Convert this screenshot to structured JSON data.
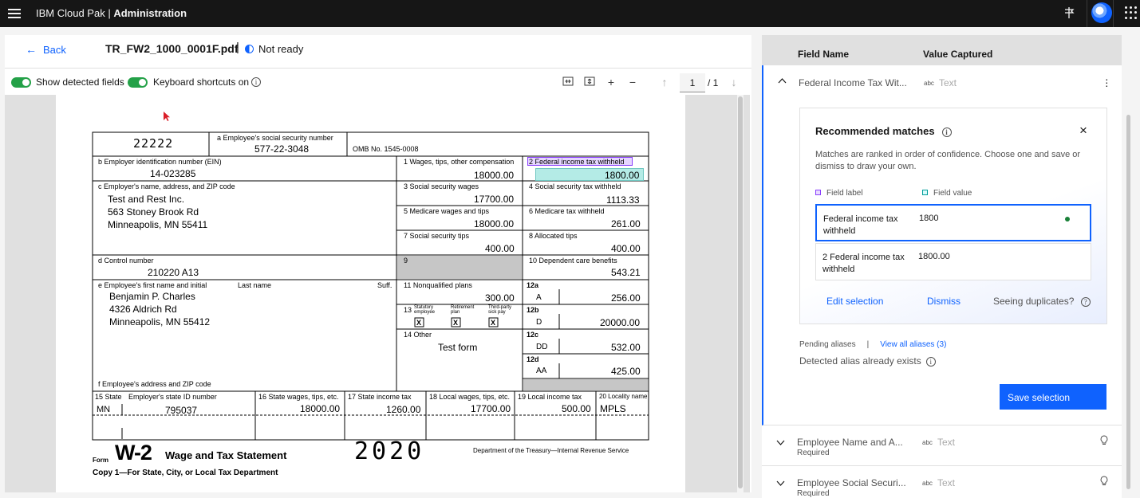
{
  "topbar": {
    "brand": "IBM Cloud Pak",
    "separator": " | ",
    "section": "Administration"
  },
  "doc": {
    "back_label": "Back",
    "filename": "TR_FW2_1000_0001F.pdf",
    "status": "Not ready"
  },
  "toolbar": {
    "show_fields": "Show detected fields",
    "shortcuts": "Keyboard shortcuts on",
    "page": "1",
    "page_total": "/ 1",
    "zoom_in": "+",
    "zoom_out": "−"
  },
  "w2": {
    "control_code": "22222",
    "ssn_label": "a Employee's social security number",
    "ssn": "577-22-3048",
    "omb": "OMB No. 1545-0008",
    "ein_label": "b Employer identification number (EIN)",
    "ein": "14-023285",
    "box1_label": "1  Wages, tips, other compensation",
    "box1": "18000.00",
    "box2_label": "2  Federal income tax withheld",
    "box2": "1800.00",
    "employer_label": "c Employer's name, address, and ZIP code",
    "employer_l1": "Test and  Rest  Inc.",
    "employer_l2": "563 Stoney Brook Rd",
    "employer_l3": "Minneapolis, MN 55411",
    "box3_label": "3  Social security wages",
    "box3": "17700.00",
    "box4_label": "4  Social security tax withheld",
    "box4": "1113.33",
    "box5_label": "5  Medicare wages and tips",
    "box5": "18000.00",
    "box6_label": "6  Medicare tax withheld",
    "box6": "261.00",
    "box7_label": "7  Social security tips",
    "box7": "400.00",
    "box8_label": "8  Allocated tips",
    "box8": "400.00",
    "control_label": "d Control number",
    "control": "210220 A13",
    "box9_label": "9",
    "box10_label": "10  Dependent care benefits",
    "box10": "543.21",
    "employee_label": "e Employee's first name and initial",
    "last_label": "Last name",
    "suff_label": "Suff.",
    "employee_l1": "Benjamin P. Charles",
    "employee_l2": "4326 Aldrich Rd",
    "employee_l3": "Minneapolis, MN 55412",
    "box11_label": "11  Nonqualified plans",
    "box11": "300.00",
    "box12a_label": "12a",
    "box12a_code": "A",
    "box12a": "256.00",
    "box13_label": "13",
    "box13_c1": "Statutory employee",
    "box13_c2": "Retirement plan",
    "box13_c3": "Third-party sick pay",
    "check": "X",
    "box12b_label": "12b",
    "box12b_code": "D",
    "box12b": "20000.00",
    "box14_label": "14  Other",
    "box14": "Test form",
    "box12c_label": "12c",
    "box12c_code": "DD",
    "box12c": "532.00",
    "box12d_label": "12d",
    "box12d_code": "AA",
    "box12d": "425.00",
    "code_letters": "Code",
    "emp_addr_label": "f Employee's address and ZIP code",
    "box15_label": "15 State",
    "state_id_label": "Employer's state ID number",
    "state": "MN",
    "state_id": "795037",
    "box16_label": "16  State wages, tips, etc.",
    "box16": "18000.00",
    "box17_label": "17  State income tax",
    "box17": "1260.00",
    "box18_label": "18  Local wages, tips, etc.",
    "box18": "17700.00",
    "box19_label": "19  Local income tax",
    "box19": "500.00",
    "box20_label": "20  Locality name",
    "box20": "MPLS",
    "form_word": "Form",
    "form_name": "W-2",
    "form_title": "Wage and Tax Statement",
    "year": "2020",
    "dept": "Department of the Treasury—Internal Revenue Service",
    "copy": "Copy 1—For State, City, or Local Tax Department"
  },
  "panel": {
    "col_field": "Field Name",
    "col_value": "Value Captured",
    "row1_name": "Federal Income Tax Wit...",
    "type_abbr": "abc",
    "type_text": "Text",
    "card_title": "Recommended matches",
    "card_desc": "Matches are ranked in order of confidence. Choose one and save or dismiss to draw your own.",
    "legend_label": "Field label",
    "legend_value": "Field value",
    "opt1_label": "Federal income tax withheld",
    "opt1_value": "1800",
    "opt2_label": "2 Federal income tax withheld",
    "opt2_value": "1800.00",
    "edit": "Edit selection",
    "dismiss": "Dismiss",
    "dup": "Seeing duplicates?",
    "pending": "Pending aliases",
    "pending_sep": "|",
    "view_aliases": "View all aliases (3)",
    "alias_exists": "Detected alias already exists",
    "save": "Save selection",
    "row2_name": "Employee Name and A...",
    "row2_req": "Required",
    "row3_name": "Employee Social Securi...",
    "row3_req": "Required"
  },
  "colors": {
    "accent": "#0f62fe",
    "success": "#24a148",
    "highlight": "#59d2c8",
    "label_highlight": "#be95ff"
  }
}
